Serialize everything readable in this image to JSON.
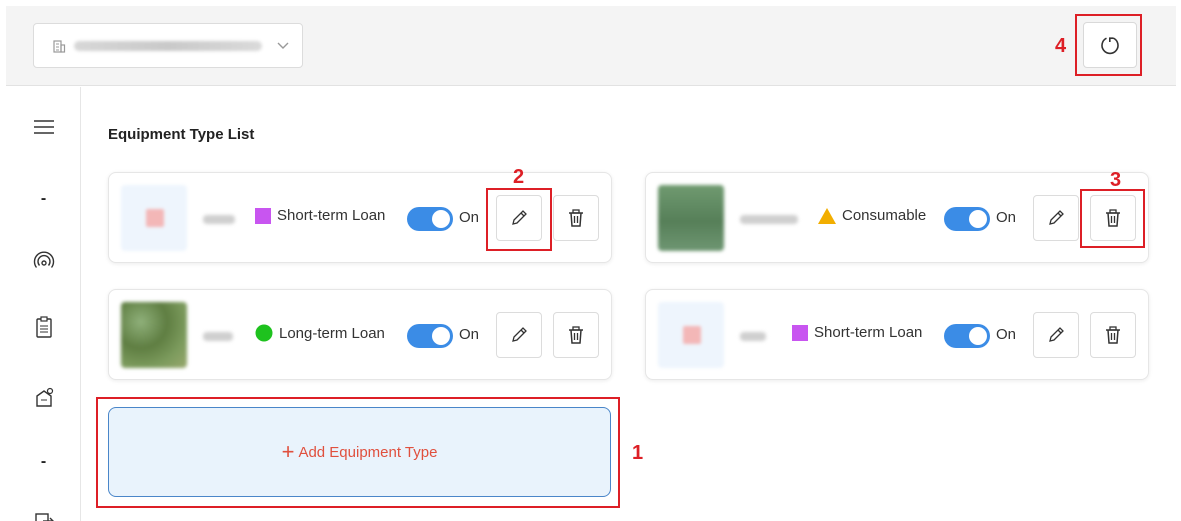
{
  "colors": {
    "accent": "#3b8ce6",
    "annotation": "#dd1f26",
    "add_text": "#e0503e",
    "short_term": "#c855f0",
    "consumable": "#f2ae00",
    "long_term": "#1ec21e"
  },
  "header": {
    "org_select_icon": "building-icon",
    "refresh_icon": "refresh-icon"
  },
  "sidebar": {
    "items": [
      {
        "icon": "menu-icon"
      },
      {
        "label": "-"
      },
      {
        "icon": "signal-icon"
      },
      {
        "icon": "clipboard-icon"
      },
      {
        "icon": "equipment-settings-icon"
      },
      {
        "label": "-"
      },
      {
        "icon": "export-icon"
      }
    ]
  },
  "main": {
    "title": "Equipment Type List",
    "cards": [
      {
        "type_label": "Short-term Loan",
        "type_marker": "square",
        "type_color": "#c855f0",
        "status": "On",
        "enabled": true,
        "thumbnail": "placeholder"
      },
      {
        "type_label": "Consumable",
        "type_marker": "triangle",
        "type_color": "#f2ae00",
        "status": "On",
        "enabled": true,
        "thumbnail": "chart"
      },
      {
        "type_label": "Long-term Loan",
        "type_marker": "circle",
        "type_color": "#1ec21e",
        "status": "On",
        "enabled": true,
        "thumbnail": "nature"
      },
      {
        "type_label": "Short-term Loan",
        "type_marker": "square",
        "type_color": "#c855f0",
        "status": "On",
        "enabled": true,
        "thumbnail": "placeholder"
      }
    ],
    "add_button": {
      "plus": "+",
      "label": "Add Equipment Type"
    }
  },
  "annotations": [
    "1",
    "2",
    "3",
    "4"
  ]
}
